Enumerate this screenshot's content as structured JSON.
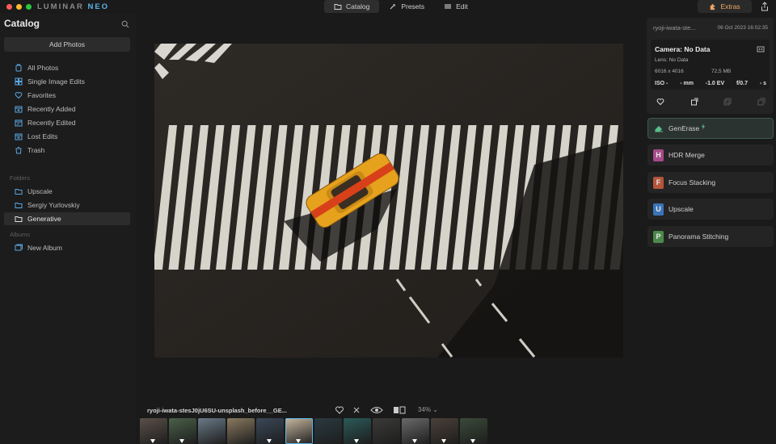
{
  "app": {
    "logo_main": "LUMINAR",
    "logo_accent": "NEO"
  },
  "topnav": {
    "tabs": [
      {
        "label": "Catalog",
        "icon": "folder-icon",
        "active": true
      },
      {
        "label": "Presets",
        "icon": "sparkle-icon",
        "active": false
      },
      {
        "label": "Edit",
        "icon": "sliders-icon",
        "active": false
      }
    ],
    "extras_label": "Extras"
  },
  "sidebar": {
    "title": "Catalog",
    "add_photos": "Add Photos",
    "library": [
      {
        "label": "All Photos",
        "icon": "photos-icon"
      },
      {
        "label": "Single Image Edits",
        "icon": "grid-icon"
      },
      {
        "label": "Favorites",
        "icon": "heart-icon"
      },
      {
        "label": "Recently Added",
        "icon": "calendar-plus-icon"
      },
      {
        "label": "Recently Edited",
        "icon": "calendar-edit-icon"
      },
      {
        "label": "Lost Edits",
        "icon": "lost-edits-icon"
      },
      {
        "label": "Trash",
        "icon": "trash-icon"
      }
    ],
    "folders_heading": "Folders",
    "folders": [
      {
        "label": "Upscale",
        "active": false
      },
      {
        "label": "Sergiy Yurlovskiy",
        "active": false
      },
      {
        "label": "Generative",
        "active": true
      }
    ],
    "albums_heading": "Albums",
    "albums": [
      {
        "label": "New Album"
      }
    ]
  },
  "info": {
    "file_name": "ryoji-iwata-ste...",
    "date": "06 Oct 2023 16:02:35",
    "camera": "Camera: No Data",
    "lens": "Lens: No Data",
    "resolution": "6016 x 4016",
    "file_size": "72,5 MB",
    "iso": "ISO -",
    "focal": "- mm",
    "ev": "-1.0 EV",
    "aperture": "f/0.7",
    "shutter": "- s"
  },
  "tools": [
    {
      "label": "GenErase",
      "letter": "",
      "color": "#58c08a"
    },
    {
      "label": "HDR Merge",
      "letter": "H",
      "color": "#a64a8a"
    },
    {
      "label": "Focus Stacking",
      "letter": "F",
      "color": "#b4553c"
    },
    {
      "label": "Upscale",
      "letter": "U",
      "color": "#3a74b8"
    },
    {
      "label": "Panorama Stitching",
      "letter": "P",
      "color": "#4a8a4a"
    }
  ],
  "filmstrip": {
    "current_file": "ryoji-iwata-stesJ0jU6SU-unsplash_before__GE...",
    "zoom": "34%",
    "thumb_colors": [
      "#5a5048",
      "#4a6048",
      "#6a7a88",
      "#8a7a60",
      "#3a4858",
      "#c8b8a0",
      "#2a3a40",
      "#2a5a58",
      "#3a3a38",
      "#6a6a6a",
      "#4a4038",
      "#3a4a38"
    ]
  }
}
